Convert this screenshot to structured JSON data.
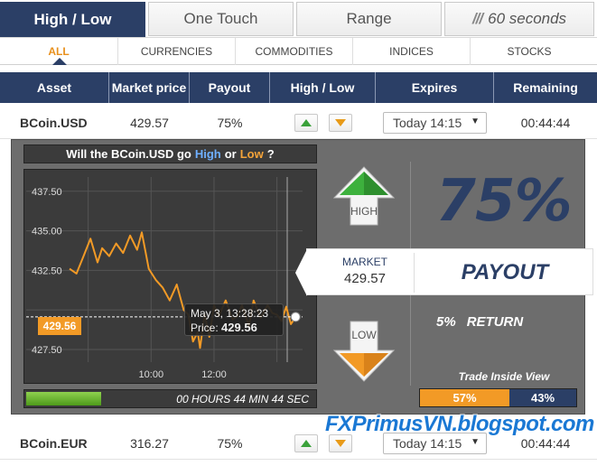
{
  "top_tabs": {
    "high_low": "High / Low",
    "one_touch": "One Touch",
    "range": "Range",
    "sixty_seconds": "60 seconds"
  },
  "category_tabs": [
    "ALL",
    "CURRENCIES",
    "COMMODITIES",
    "INDICES",
    "STOCKS"
  ],
  "table_headers": [
    "Asset",
    "Market price",
    "Payout",
    "High / Low",
    "Expires",
    "Remaining"
  ],
  "rows": [
    {
      "asset": "BCoin.USD",
      "price": "429.57",
      "payout": "75%",
      "expires": "Today 14:15",
      "remaining": "00:44:44"
    },
    {
      "asset": "BCoin.EUR",
      "price": "316.27",
      "payout": "75%",
      "expires": "Today 14:15",
      "remaining": "00:44:44"
    }
  ],
  "panel": {
    "question_prefix": "Will the BCoin.USD go",
    "question_high": "High",
    "question_or": "or",
    "question_low": "Low",
    "question_suffix": "?",
    "high_label": "HIGH",
    "low_label": "LOW",
    "market_label": "MARKET",
    "market_value": "429.57",
    "payout_word": "PAYOUT",
    "payout_pct": "75%",
    "return_pct": "5%",
    "return_label": "RETURN",
    "trade_inside": "Trade Inside View",
    "sentiment_high": "57%",
    "sentiment_low": "43%",
    "sentiment_high_fraction": 0.57,
    "timer_text": "00 HOURS 44 MIN 44 SEC",
    "timer_fraction": 0.26,
    "tooltip_date": "May 3, 13:28:23",
    "tooltip_price_label": "Price:",
    "tooltip_price": "429.56",
    "current_price_tag": "429.56"
  },
  "colors": {
    "navy": "#2b3f66",
    "orange": "#f29a26",
    "green": "#3aa13a",
    "panel_grey": "#6d6d6d"
  },
  "chart_data": {
    "type": "line",
    "title": "",
    "xlabel": "",
    "ylabel": "",
    "x_ticks": [
      "10:00",
      "12:00"
    ],
    "y_ticks": [
      437.5,
      435.0,
      432.5,
      430.0,
      427.5
    ],
    "ylim": [
      426.7,
      438.4
    ],
    "xlim": [
      0,
      100
    ],
    "current_price": 429.56,
    "series": [
      {
        "x": [
          0,
          3,
          6,
          9,
          12,
          14,
          17,
          20,
          23,
          26,
          29,
          31,
          34,
          37,
          40,
          43,
          46,
          49,
          51,
          53,
          55,
          56,
          58,
          60,
          62,
          64,
          67,
          70,
          72,
          74,
          77,
          79,
          82,
          85,
          87,
          89,
          91,
          93,
          95,
          97
        ],
        "y": [
          432.6,
          432.3,
          433.4,
          434.5,
          433.0,
          433.9,
          433.4,
          434.2,
          433.6,
          434.7,
          433.8,
          434.9,
          432.6,
          431.9,
          431.4,
          430.6,
          431.6,
          430.0,
          429.7,
          428.0,
          428.6,
          427.6,
          429.7,
          428.3,
          430.3,
          429.6,
          430.6,
          429.4,
          429.6,
          430.3,
          429.0,
          430.6,
          429.5,
          430.3,
          429.8,
          429.7,
          429.3,
          430.2,
          429.1,
          429.56
        ]
      }
    ],
    "grid": true
  },
  "watermark": "FXPrimusVN.blogspot.com"
}
